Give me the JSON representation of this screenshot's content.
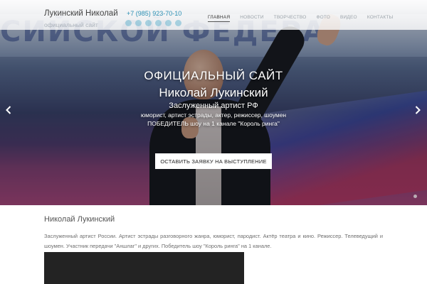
{
  "header": {
    "site_title": "Лукинский Николай",
    "site_subtitle": "официальный сайт",
    "phone": "+7 (985) 923-70-10",
    "social_icons": [
      "vk-icon",
      "facebook-icon",
      "twitter-icon",
      "odnoklassniki-icon",
      "instagram-icon",
      "youtube-icon"
    ],
    "nav": [
      {
        "label": "Главная",
        "active": true
      },
      {
        "label": "Новости",
        "active": false
      },
      {
        "label": "Творчество",
        "active": false
      },
      {
        "label": "Фото",
        "active": false
      },
      {
        "label": "Видео",
        "active": false
      },
      {
        "label": "Контакты",
        "active": false
      }
    ]
  },
  "hero": {
    "background_banner_text": "СИЙСКОЙ ФЕДЕРА",
    "line1": "ОФИЦИАЛЬНЫЙ САЙТ",
    "line2": "Николай Лукинский",
    "line3": "Заслуженный артист РФ",
    "line4": "юморист, артист эстрады, актер, режиссер, шоумен",
    "line5": "ПОБЕДИТЕЛЬ шоу на 1 канале \"Король ринга\"",
    "cta_label": "Оставить заявку на выступление",
    "prev_icon": "chevron-left-icon",
    "next_icon": "chevron-right-icon",
    "slide_count": 1,
    "active_slide": 1
  },
  "content": {
    "title": "Николай Лукинский",
    "bio": "Заслуженный артист России. Артист эстрады разговорного жанра, юморист, пародист. Актёр театра и кино. Режиссер. Телеведущий и шоумен. Участник передачи \"Аншлаг\" и других. Победитель шоу \"Король ринга\" на 1 канале."
  },
  "colors": {
    "accent": "#2b8fb3",
    "nav_inactive": "#9ba3aa",
    "nav_active": "#333333",
    "video_bg": "#232323"
  }
}
